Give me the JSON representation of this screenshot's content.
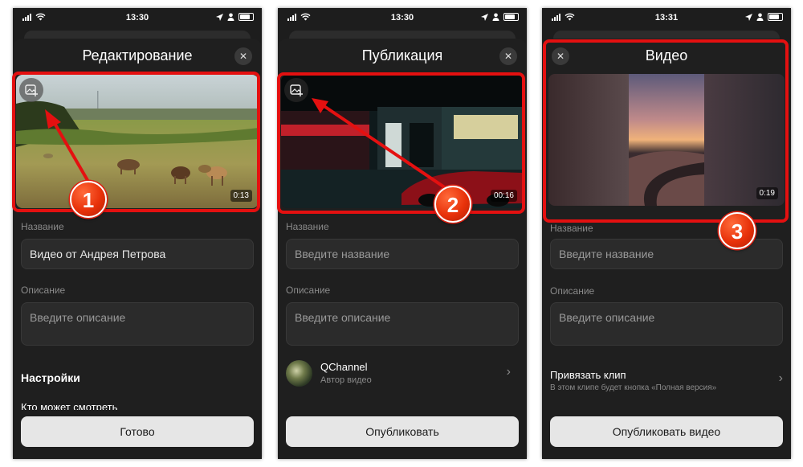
{
  "status_bar": {
    "times": [
      "13:30",
      "13:30",
      "13:31"
    ]
  },
  "screens": [
    {
      "title": "Редактирование",
      "duration": "0:13",
      "name_label": "Название",
      "name_value": "Видео от Андрея Петрова",
      "description_label": "Описание",
      "description_placeholder": "Введите описание",
      "settings_title": "Настройки",
      "settings_item": "Кто может смотреть",
      "action_button": "Готово"
    },
    {
      "title": "Публикация",
      "duration": "00:16",
      "name_label": "Название",
      "name_placeholder": "Введите название",
      "description_label": "Описание",
      "description_placeholder": "Введите описание",
      "author_name": "QChannel",
      "author_role": "Автор видео",
      "action_button": "Опубликовать"
    },
    {
      "title": "Видео",
      "duration": "0:19",
      "name_label": "Название",
      "name_placeholder": "Введите название",
      "description_label": "Описание",
      "description_placeholder": "Введите описание",
      "clip_title": "Привязать клип",
      "clip_subtitle": "В этом клипе будет кнопка «Полная версия»",
      "action_button": "Опубликовать видео"
    }
  ],
  "annotations": {
    "badges": [
      "1",
      "2",
      "3"
    ],
    "highlight_color": "#e41010"
  },
  "icons": {
    "close": "close-icon",
    "change_cover": "image-plus-icon",
    "chevron": "chevron-right-icon",
    "wifi": "wifi-icon",
    "signal": "signal-icon",
    "location": "location-arrow-icon",
    "person": "person-icon",
    "battery": "battery-icon"
  }
}
